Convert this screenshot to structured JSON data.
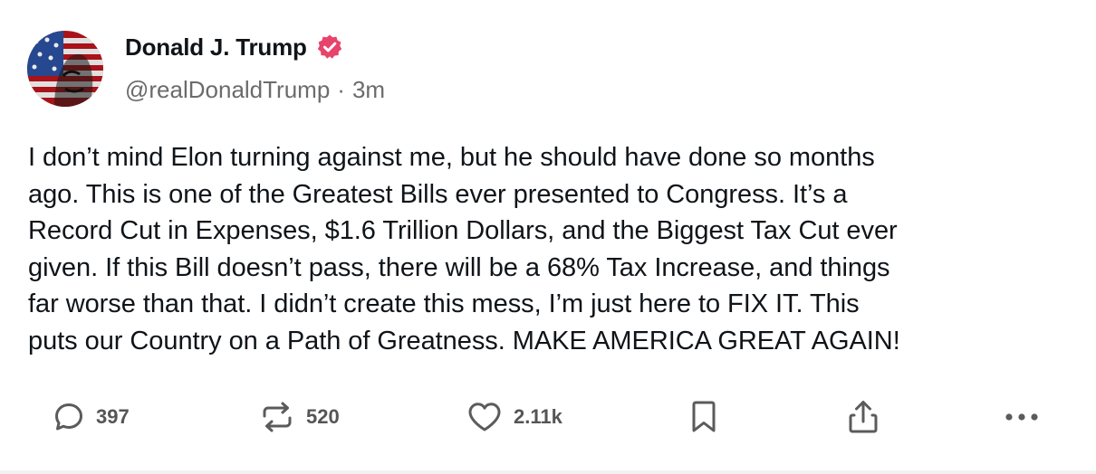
{
  "author": {
    "display_name": "Donald J. Trump",
    "handle": "@realDonaldTrump",
    "separator": "·",
    "time_ago": "3m",
    "verified_icon": "verified-badge-icon",
    "verified_color": "#e8436b"
  },
  "post": {
    "text": "I don’t mind Elon turning against me, but he should have done so months\nago. This is one of the Greatest Bills ever presented to Congress. It’s a\nRecord Cut in Expenses, $1.6 Trillion Dollars, and the Biggest Tax Cut ever\ngiven. If this Bill doesn’t pass, there will be a 68% Tax Increase, and things\nfar worse than that. I didn’t create this mess, I’m just here to FIX IT. This\nputs our Country on a Path of Greatness. MAKE AMERICA GREAT AGAIN!"
  },
  "actions": {
    "reply": {
      "icon": "reply-icon",
      "count": "397"
    },
    "repost": {
      "icon": "repost-icon",
      "count": "520"
    },
    "like": {
      "icon": "heart-icon",
      "count": "2.11k"
    },
    "bookmark": {
      "icon": "bookmark-icon"
    },
    "share": {
      "icon": "share-icon"
    },
    "more": {
      "icon": "more-icon"
    }
  },
  "colors": {
    "text": "#0f1419",
    "muted": "#6b6b6b",
    "icon": "#5b5b5b"
  }
}
